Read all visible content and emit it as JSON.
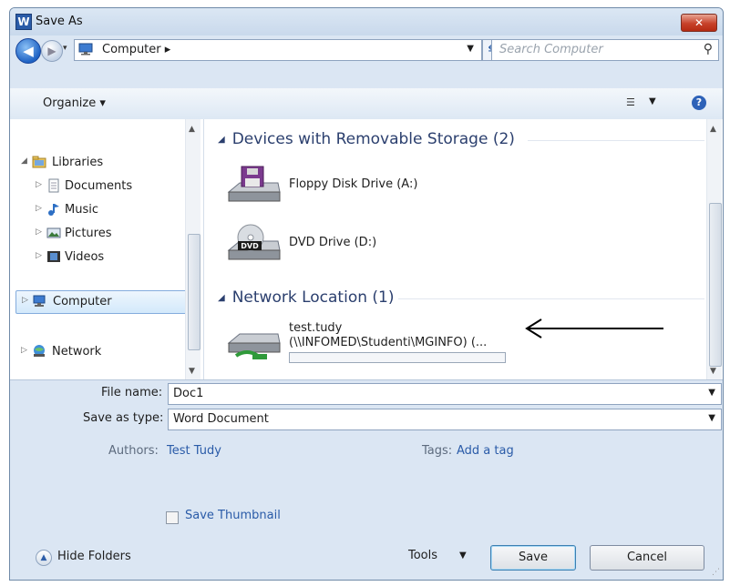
{
  "window": {
    "title": "Save As",
    "app_icon_letter": "W",
    "close_label": "✕"
  },
  "address_bar": {
    "crumb": "Computer ▸",
    "search_placeholder": "Search Computer"
  },
  "toolbar": {
    "organize_label": "Organize ▾",
    "help_label": "?"
  },
  "nav_pane": {
    "libraries": "Libraries",
    "documents": "Documents",
    "music": "Music",
    "pictures": "Pictures",
    "videos": "Videos",
    "computer": "Computer",
    "network": "Network"
  },
  "content": {
    "group_removable": "Devices with Removable Storage (2)",
    "floppy": "Floppy Disk Drive (A:)",
    "dvd": "DVD Drive (D:)",
    "dvd_icon_text": "DVD",
    "group_network": "Network Location (1)",
    "netloc_line1": "test.tudy",
    "netloc_line2": "(\\\\INFOMED\\Studenti\\MGINFO) (..."
  },
  "form": {
    "filename_label": "File name:",
    "filename_value": "Doc1",
    "savetype_label": "Save as type:",
    "savetype_value": "Word Document",
    "authors_label": "Authors:",
    "authors_value": "Test Tudy",
    "tags_label": "Tags:",
    "tags_value": "Add a tag",
    "thumbnail_label": "Save Thumbnail"
  },
  "footer": {
    "hide_folders": "Hide Folders",
    "tools": "Tools",
    "save": "Save",
    "cancel": "Cancel"
  },
  "colors": {
    "chrome": "#dbe6f3",
    "link": "#2a5ba8",
    "group_header": "#2b3f6e",
    "close": "#c7412a"
  }
}
